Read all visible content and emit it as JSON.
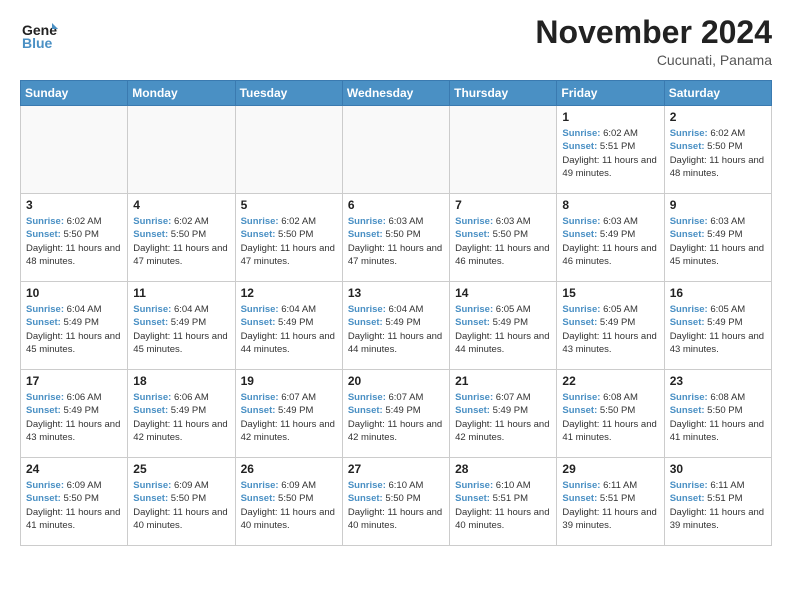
{
  "header": {
    "logo_general": "General",
    "logo_blue": "Blue",
    "month_title": "November 2024",
    "location": "Cucunati, Panama"
  },
  "weekdays": [
    "Sunday",
    "Monday",
    "Tuesday",
    "Wednesday",
    "Thursday",
    "Friday",
    "Saturday"
  ],
  "weeks": [
    [
      {
        "day": "",
        "empty": true
      },
      {
        "day": "",
        "empty": true
      },
      {
        "day": "",
        "empty": true
      },
      {
        "day": "",
        "empty": true
      },
      {
        "day": "",
        "empty": true
      },
      {
        "day": "1",
        "sunrise": "6:02 AM",
        "sunset": "5:51 PM",
        "daylight": "11 hours and 49 minutes."
      },
      {
        "day": "2",
        "sunrise": "6:02 AM",
        "sunset": "5:50 PM",
        "daylight": "11 hours and 48 minutes."
      }
    ],
    [
      {
        "day": "3",
        "sunrise": "6:02 AM",
        "sunset": "5:50 PM",
        "daylight": "11 hours and 48 minutes."
      },
      {
        "day": "4",
        "sunrise": "6:02 AM",
        "sunset": "5:50 PM",
        "daylight": "11 hours and 47 minutes."
      },
      {
        "day": "5",
        "sunrise": "6:02 AM",
        "sunset": "5:50 PM",
        "daylight": "11 hours and 47 minutes."
      },
      {
        "day": "6",
        "sunrise": "6:03 AM",
        "sunset": "5:50 PM",
        "daylight": "11 hours and 47 minutes."
      },
      {
        "day": "7",
        "sunrise": "6:03 AM",
        "sunset": "5:50 PM",
        "daylight": "11 hours and 46 minutes."
      },
      {
        "day": "8",
        "sunrise": "6:03 AM",
        "sunset": "5:49 PM",
        "daylight": "11 hours and 46 minutes."
      },
      {
        "day": "9",
        "sunrise": "6:03 AM",
        "sunset": "5:49 PM",
        "daylight": "11 hours and 45 minutes."
      }
    ],
    [
      {
        "day": "10",
        "sunrise": "6:04 AM",
        "sunset": "5:49 PM",
        "daylight": "11 hours and 45 minutes."
      },
      {
        "day": "11",
        "sunrise": "6:04 AM",
        "sunset": "5:49 PM",
        "daylight": "11 hours and 45 minutes."
      },
      {
        "day": "12",
        "sunrise": "6:04 AM",
        "sunset": "5:49 PM",
        "daylight": "11 hours and 44 minutes."
      },
      {
        "day": "13",
        "sunrise": "6:04 AM",
        "sunset": "5:49 PM",
        "daylight": "11 hours and 44 minutes."
      },
      {
        "day": "14",
        "sunrise": "6:05 AM",
        "sunset": "5:49 PM",
        "daylight": "11 hours and 44 minutes."
      },
      {
        "day": "15",
        "sunrise": "6:05 AM",
        "sunset": "5:49 PM",
        "daylight": "11 hours and 43 minutes."
      },
      {
        "day": "16",
        "sunrise": "6:05 AM",
        "sunset": "5:49 PM",
        "daylight": "11 hours and 43 minutes."
      }
    ],
    [
      {
        "day": "17",
        "sunrise": "6:06 AM",
        "sunset": "5:49 PM",
        "daylight": "11 hours and 43 minutes."
      },
      {
        "day": "18",
        "sunrise": "6:06 AM",
        "sunset": "5:49 PM",
        "daylight": "11 hours and 42 minutes."
      },
      {
        "day": "19",
        "sunrise": "6:07 AM",
        "sunset": "5:49 PM",
        "daylight": "11 hours and 42 minutes."
      },
      {
        "day": "20",
        "sunrise": "6:07 AM",
        "sunset": "5:49 PM",
        "daylight": "11 hours and 42 minutes."
      },
      {
        "day": "21",
        "sunrise": "6:07 AM",
        "sunset": "5:49 PM",
        "daylight": "11 hours and 42 minutes."
      },
      {
        "day": "22",
        "sunrise": "6:08 AM",
        "sunset": "5:50 PM",
        "daylight": "11 hours and 41 minutes."
      },
      {
        "day": "23",
        "sunrise": "6:08 AM",
        "sunset": "5:50 PM",
        "daylight": "11 hours and 41 minutes."
      }
    ],
    [
      {
        "day": "24",
        "sunrise": "6:09 AM",
        "sunset": "5:50 PM",
        "daylight": "11 hours and 41 minutes."
      },
      {
        "day": "25",
        "sunrise": "6:09 AM",
        "sunset": "5:50 PM",
        "daylight": "11 hours and 40 minutes."
      },
      {
        "day": "26",
        "sunrise": "6:09 AM",
        "sunset": "5:50 PM",
        "daylight": "11 hours and 40 minutes."
      },
      {
        "day": "27",
        "sunrise": "6:10 AM",
        "sunset": "5:50 PM",
        "daylight": "11 hours and 40 minutes."
      },
      {
        "day": "28",
        "sunrise": "6:10 AM",
        "sunset": "5:51 PM",
        "daylight": "11 hours and 40 minutes."
      },
      {
        "day": "29",
        "sunrise": "6:11 AM",
        "sunset": "5:51 PM",
        "daylight": "11 hours and 39 minutes."
      },
      {
        "day": "30",
        "sunrise": "6:11 AM",
        "sunset": "5:51 PM",
        "daylight": "11 hours and 39 minutes."
      }
    ]
  ],
  "labels": {
    "sunrise": "Sunrise:",
    "sunset": "Sunset:",
    "daylight": "Daylight hours"
  }
}
